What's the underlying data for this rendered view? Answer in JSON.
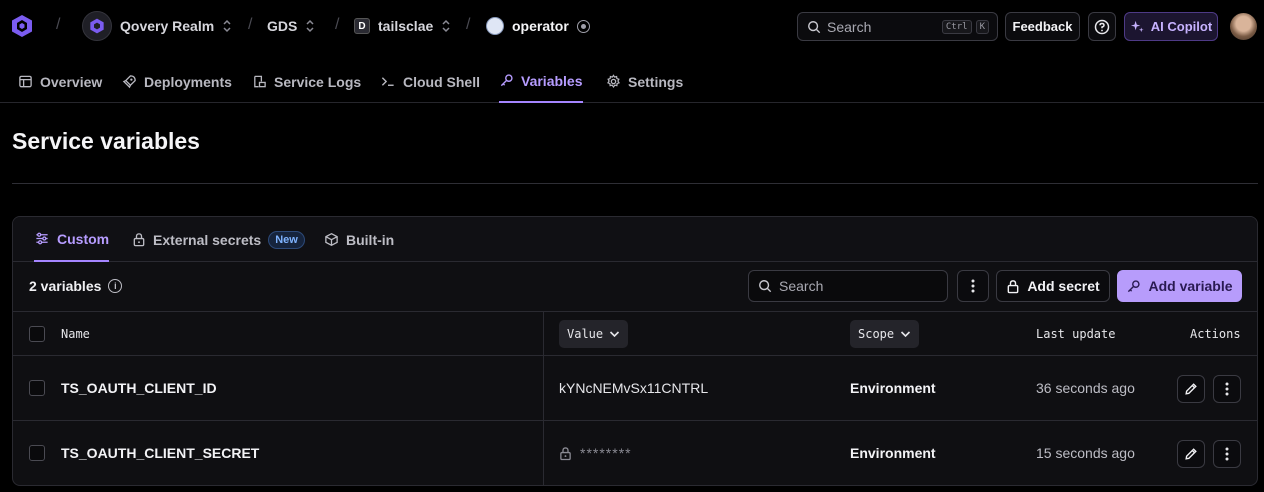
{
  "breadcrumb": {
    "organization": "Qovery Realm",
    "project": "GDS",
    "environment": "tailsclae",
    "environment_letter": "D",
    "service": "operator"
  },
  "header": {
    "search_label": "Search",
    "search_shortcut_ctrl": "Ctrl",
    "search_shortcut_key": "K",
    "feedback_label": "Feedback",
    "copilot_label": "AI Copilot"
  },
  "tabs": [
    {
      "label": "Overview",
      "icon": "overview-icon"
    },
    {
      "label": "Deployments",
      "icon": "rocket-icon"
    },
    {
      "label": "Service Logs",
      "icon": "logs-icon"
    },
    {
      "label": "Cloud Shell",
      "icon": "terminal-icon"
    },
    {
      "label": "Variables",
      "icon": "key-icon",
      "active": true
    },
    {
      "label": "Settings",
      "icon": "gear-icon"
    }
  ],
  "page_title": "Service variables",
  "subtabs": [
    {
      "label": "Custom",
      "icon": "sliders-icon",
      "active": true
    },
    {
      "label": "External secrets",
      "icon": "lock-icon",
      "badge": "New"
    },
    {
      "label": "Built-in",
      "icon": "cube-icon"
    }
  ],
  "toolbar": {
    "count_label": "2 variables",
    "search_placeholder": "Search",
    "add_secret_label": "Add secret",
    "add_variable_label": "Add variable"
  },
  "table": {
    "columns": {
      "name": "Name",
      "value": "Value",
      "scope": "Scope",
      "last_update": "Last update",
      "actions": "Actions"
    },
    "rows": [
      {
        "name": "TS_OAUTH_CLIENT_ID",
        "value": "kYNcNEMvSx11CNTRL",
        "secret": false,
        "scope": "Environment",
        "last_update": "36 seconds ago"
      },
      {
        "name": "TS_OAUTH_CLIENT_SECRET",
        "value": "********",
        "secret": true,
        "scope": "Environment",
        "last_update": "15 seconds ago"
      }
    ]
  },
  "colors": {
    "accent": "#a585ff",
    "background": "#000000",
    "card": "#0f0f12",
    "primary_button": "#b79cfb"
  }
}
